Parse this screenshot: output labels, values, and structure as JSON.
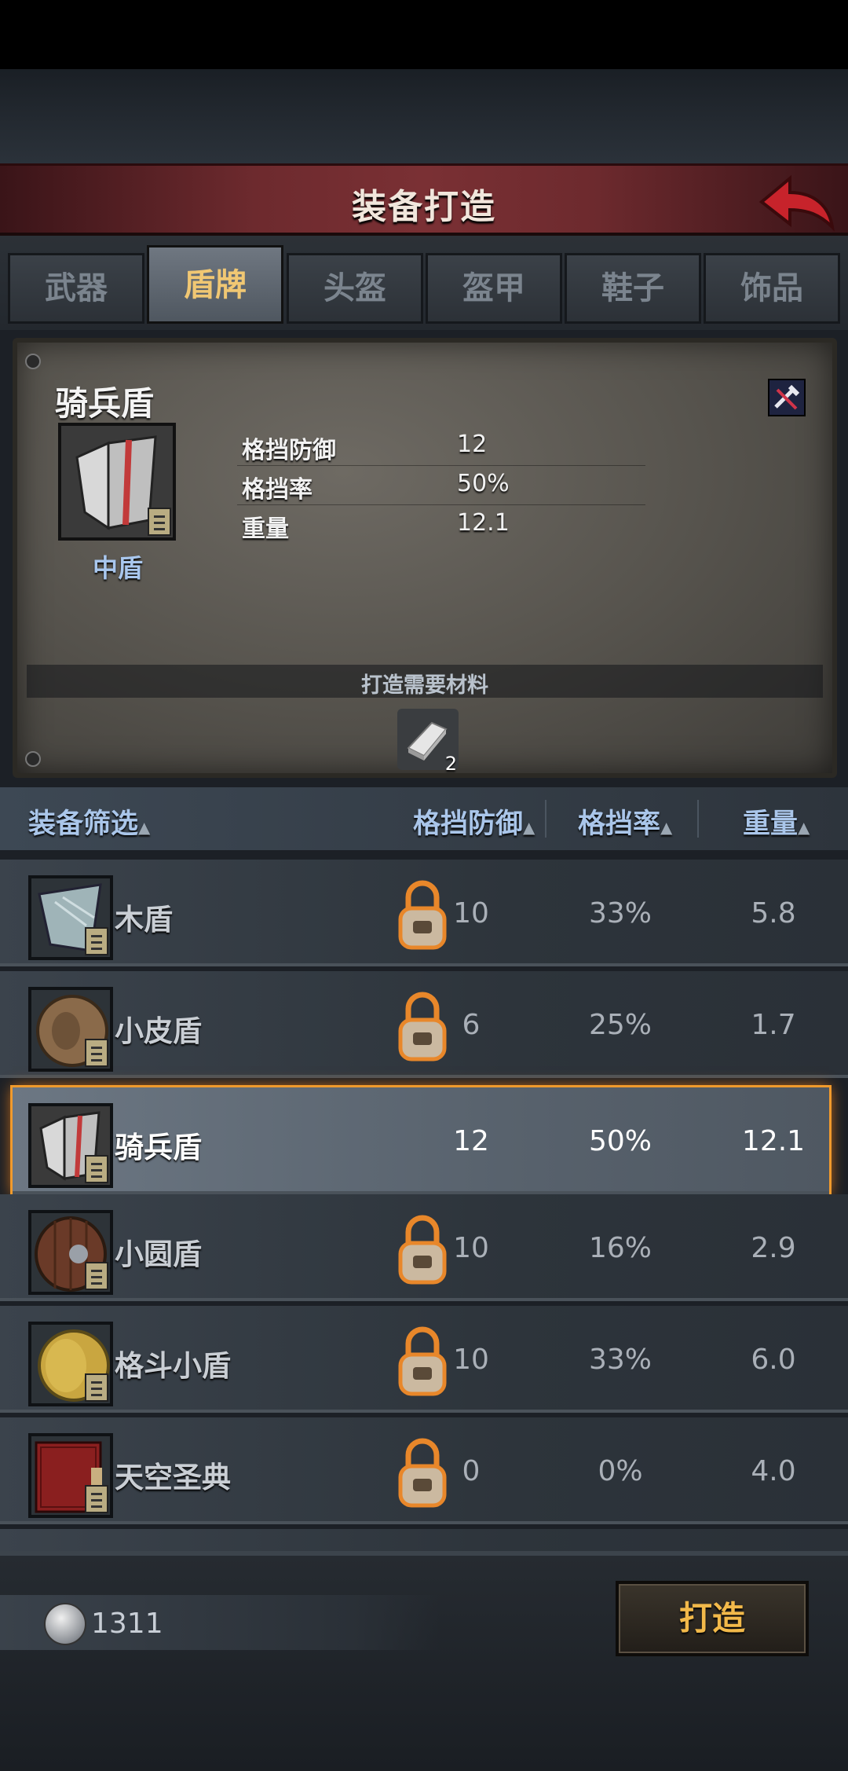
{
  "header": {
    "title": "装备打造"
  },
  "tabs": [
    {
      "label": "武器",
      "active": false
    },
    {
      "label": "盾牌",
      "active": true
    },
    {
      "label": "头盔",
      "active": false
    },
    {
      "label": "盔甲",
      "active": false
    },
    {
      "label": "鞋子",
      "active": false
    },
    {
      "label": "饰品",
      "active": false
    }
  ],
  "detail": {
    "name": "骑兵盾",
    "type": "中盾",
    "stats": [
      {
        "label": "格挡防御",
        "value": "12"
      },
      {
        "label": "格挡率",
        "value": "50%"
      },
      {
        "label": "重量",
        "value": "12.1"
      }
    ],
    "materials_title": "打造需要材料",
    "material_count": "2"
  },
  "filter": {
    "filter_label": "装备筛选",
    "col_defense": "格挡防御",
    "col_rate": "格挡率",
    "col_weight": "重量"
  },
  "items": [
    {
      "name": "木盾",
      "defense": "10",
      "rate": "33%",
      "weight": "5.8",
      "locked": true,
      "selected": false
    },
    {
      "name": "小皮盾",
      "defense": "6",
      "rate": "25%",
      "weight": "1.7",
      "locked": true,
      "selected": false
    },
    {
      "name": "骑兵盾",
      "defense": "12",
      "rate": "50%",
      "weight": "12.1",
      "locked": false,
      "selected": true
    },
    {
      "name": "小圆盾",
      "defense": "10",
      "rate": "16%",
      "weight": "2.9",
      "locked": true,
      "selected": false
    },
    {
      "name": "格斗小盾",
      "defense": "10",
      "rate": "33%",
      "weight": "6.0",
      "locked": true,
      "selected": false
    },
    {
      "name": "天空圣典",
      "defense": "0",
      "rate": "0%",
      "weight": "4.0",
      "locked": true,
      "selected": false
    }
  ],
  "footer": {
    "coins": "1311",
    "forge_label": "打造"
  },
  "colors": {
    "accent_orange": "#f09a2c",
    "tab_active_text": "#f0c773",
    "header_red": "#7a3034"
  }
}
